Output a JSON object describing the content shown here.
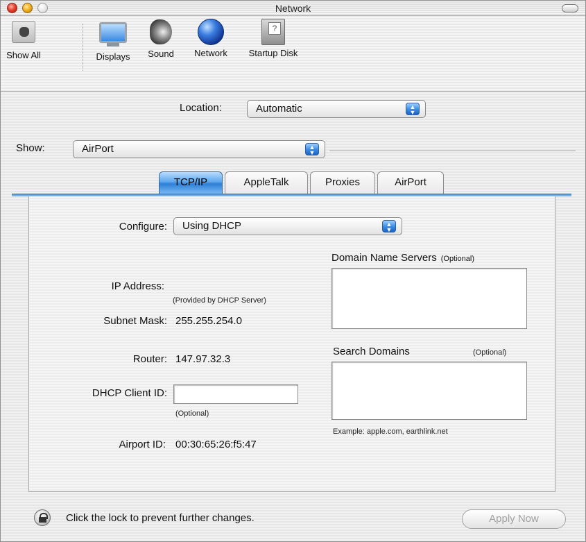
{
  "window": {
    "title": "Network"
  },
  "toolbar": {
    "items": [
      {
        "label": "Show All",
        "icon": "apple-grid-icon"
      },
      {
        "label": "Displays",
        "icon": "display-icon"
      },
      {
        "label": "Sound",
        "icon": "speaker-icon"
      },
      {
        "label": "Network",
        "icon": "globe-icon"
      },
      {
        "label": "Startup Disk",
        "icon": "hard-disk-icon"
      }
    ]
  },
  "location": {
    "label": "Location:",
    "value": "Automatic"
  },
  "show": {
    "label": "Show:",
    "value": "AirPort"
  },
  "tabs": [
    {
      "label": "TCP/IP",
      "active": true
    },
    {
      "label": "AppleTalk",
      "active": false
    },
    {
      "label": "Proxies",
      "active": false
    },
    {
      "label": "AirPort",
      "active": false
    }
  ],
  "tcpip": {
    "configure_label": "Configure:",
    "configure_value": "Using DHCP",
    "ip_label": "IP Address:",
    "ip_note": "(Provided by DHCP Server)",
    "subnet_label": "Subnet Mask:",
    "subnet_value": "255.255.254.0",
    "router_label": "Router:",
    "router_value": "147.97.32.3",
    "dhcp_client_label": "DHCP Client ID:",
    "dhcp_client_value": "",
    "dhcp_client_note": "(Optional)",
    "airport_id_label": "Airport ID:",
    "airport_id_value": "00:30:65:26:f5:47",
    "dns_label": "Domain Name Servers",
    "dns_optional": "(Optional)",
    "search_label": "Search Domains",
    "search_optional": "(Optional)",
    "search_example": "Example: apple.com, earthlink.net"
  },
  "footer": {
    "lock_text": "Click the lock to prevent further changes.",
    "apply_label": "Apply Now"
  }
}
